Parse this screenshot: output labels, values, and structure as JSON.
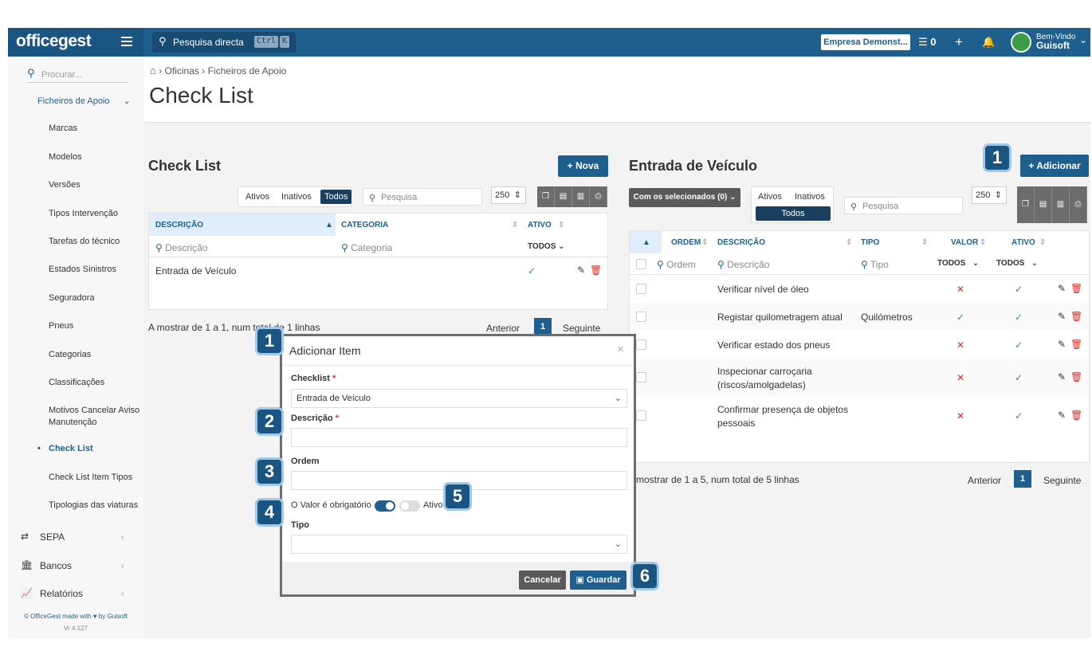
{
  "topbar": {
    "logo": "officegest",
    "search_label": "Pesquisa directa",
    "kbd_ctrl": "Ctrl",
    "kbd_k": "K",
    "company": "Empresa Demonst...",
    "task_count": "0",
    "welcome": "Bem-Vindo",
    "user": "Guisoft"
  },
  "sidebar": {
    "search_placeholder": "Procurar...",
    "group": "Ficheiros de Apoio",
    "items": [
      "Marcas",
      "Modelos",
      "Versões",
      "Tipos Intervenção",
      "Tarefas do técnico",
      "Estados Sinistros",
      "Seguradora",
      "Pneus",
      "Categorias",
      "Classificações",
      "Motivos Cancelar Aviso",
      "Manutenção",
      "Check List",
      "Check List Item Tipos",
      "Tipologias das viaturas"
    ],
    "main": [
      "SEPA",
      "Bancos",
      "Relatórios"
    ],
    "footer": "© OfficeGest made with ♥ by Guisoft",
    "version": "Vr 4.127"
  },
  "breadcrumb": {
    "home": "⌂",
    "b1": "Oficinas",
    "b2": "Ficheiros de Apoio"
  },
  "page_title": "Check List",
  "left": {
    "title": "Check List",
    "new_btn": "+ Nova",
    "seg": [
      "Ativos",
      "Inativos",
      "Todos"
    ],
    "search_ph": "Pesquisa",
    "page_size": "250",
    "cols": [
      "DESCRIÇÃO",
      "CATEGORIA",
      "ATIVO"
    ],
    "filter_desc": "Descrição",
    "filter_cat": "Categoria",
    "filter_all": "TODOS",
    "row_desc": "Entrada de Veículo",
    "info": "A mostrar de 1 a 1, num total de 1 linhas",
    "prev": "Anterior",
    "page": "1",
    "next": "Seguinte"
  },
  "right": {
    "title": "Entrada de Veículo",
    "add_btn": "+ Adicionar",
    "bulk": "Com os selecionados (0)",
    "seg": [
      "Ativos",
      "Inativos",
      "Todos"
    ],
    "search_ph": "Pesquisa",
    "page_size": "250",
    "cols": [
      "ORDEM",
      "DESCRIÇÃO",
      "TIPO",
      "VALOR",
      "ATIVO"
    ],
    "f_ordem": "Ordem",
    "f_desc": "Descrição",
    "f_tipo": "Tipo",
    "f_all": "TODOS",
    "rows": [
      {
        "d1": "Verificar nível de óleo",
        "d2": "",
        "tipo": "",
        "valor": "✕",
        "ativo": "✓"
      },
      {
        "d1": "Registar quilometragem atual",
        "d2": "",
        "tipo": "Quilómetros",
        "valor": "✓",
        "ativo": "✓"
      },
      {
        "d1": "Verificar estado dos pneus",
        "d2": "",
        "tipo": "",
        "valor": "✕",
        "ativo": "✓"
      },
      {
        "d1": "Inspecionar carroçaria",
        "d2": "(riscos/amolgadelas)",
        "tipo": "",
        "valor": "✕",
        "ativo": "✓"
      },
      {
        "d1": "Confirmar presença de objetos",
        "d2": "pessoais",
        "tipo": "",
        "valor": "✕",
        "ativo": "✓"
      }
    ],
    "info": "mostrar de 1 a 5, num total de 5 linhas",
    "prev": "Anterior",
    "page": "1",
    "next": "Seguinte"
  },
  "modal": {
    "title": "Adicionar Item",
    "checklist_label": "Checklist",
    "checklist_value": "Entrada de Veículo",
    "desc_label": "Descrição",
    "ordem_label": "Ordem",
    "valor_label": "O Valor é obrigatório",
    "ativo_label": "Ativo",
    "tipo_label": "Tipo",
    "cancel": "Cancelar",
    "save": "Guardar"
  },
  "badges": [
    "1",
    "1",
    "2",
    "3",
    "4",
    "5",
    "6"
  ],
  "colors": {
    "brand": "#1e5f8e",
    "check": "#2e9a4a",
    "cross": "#d9332a"
  }
}
